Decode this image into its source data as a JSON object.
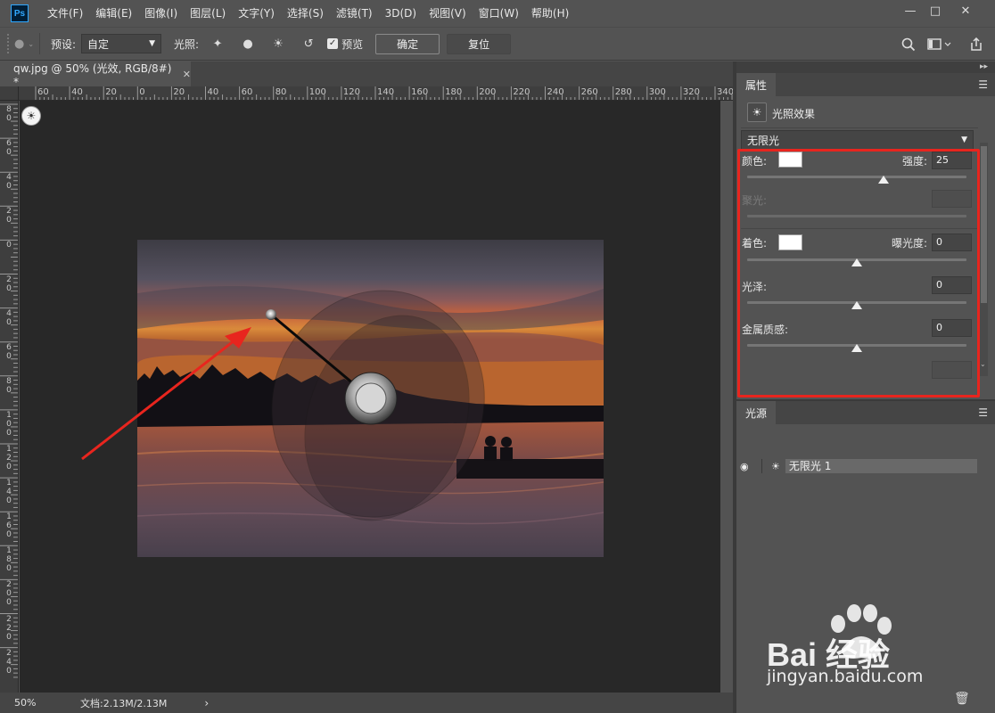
{
  "app": {
    "logo": "Ps"
  },
  "menu": [
    "文件(F)",
    "编辑(E)",
    "图像(I)",
    "图层(L)",
    "文字(Y)",
    "选择(S)",
    "滤镜(T)",
    "3D(D)",
    "视图(V)",
    "窗口(W)",
    "帮助(H)"
  ],
  "options": {
    "preset_label": "预设:",
    "preset_value": "自定",
    "lights_label": "光照:",
    "preview_label": "预览",
    "preview_checked": true,
    "ok_label": "确定",
    "reset_label": "复位"
  },
  "document": {
    "tab_title": "qw.jpg @ 50% (光效, RGB/8#) *",
    "zoom": "50%",
    "doc_size": "文档:2.13M/2.13M"
  },
  "rulers": {
    "h_labels": [
      "60",
      "40",
      "20",
      "0",
      "20",
      "40",
      "60",
      "80",
      "100",
      "120",
      "140",
      "160",
      "180",
      "200",
      "220",
      "240",
      "260",
      "280",
      "300",
      "320",
      "340"
    ],
    "v_labels": [
      "80",
      "60",
      "40",
      "20",
      "0",
      "20",
      "40",
      "60",
      "80",
      "100",
      "120",
      "140",
      "160",
      "180",
      "200",
      "220",
      "240"
    ]
  },
  "properties": {
    "tab": "属性",
    "title": "光照效果",
    "light_type": "无限光",
    "color_label": "颜色:",
    "intensity_label": "强度:",
    "intensity_value": "25",
    "intensity_fraction": 0.62,
    "hotspot_label": "聚光:",
    "colorize_label": "着色:",
    "exposure_label": "曝光度:",
    "exposure_value": "0",
    "exposure_fraction": 0.5,
    "gloss_label": "光泽:",
    "gloss_value": "0",
    "gloss_fraction": 0.5,
    "metallic_label": "金属质感:",
    "metallic_value": "0",
    "metallic_fraction": 0.5,
    "accent_color": "#e8251e"
  },
  "lights_panel": {
    "tab": "光源",
    "items": [
      {
        "name": "无限光 1",
        "visible": true
      }
    ]
  },
  "watermark": {
    "brand": "Bai 经验",
    "url": "jingyan.baidu.com"
  }
}
